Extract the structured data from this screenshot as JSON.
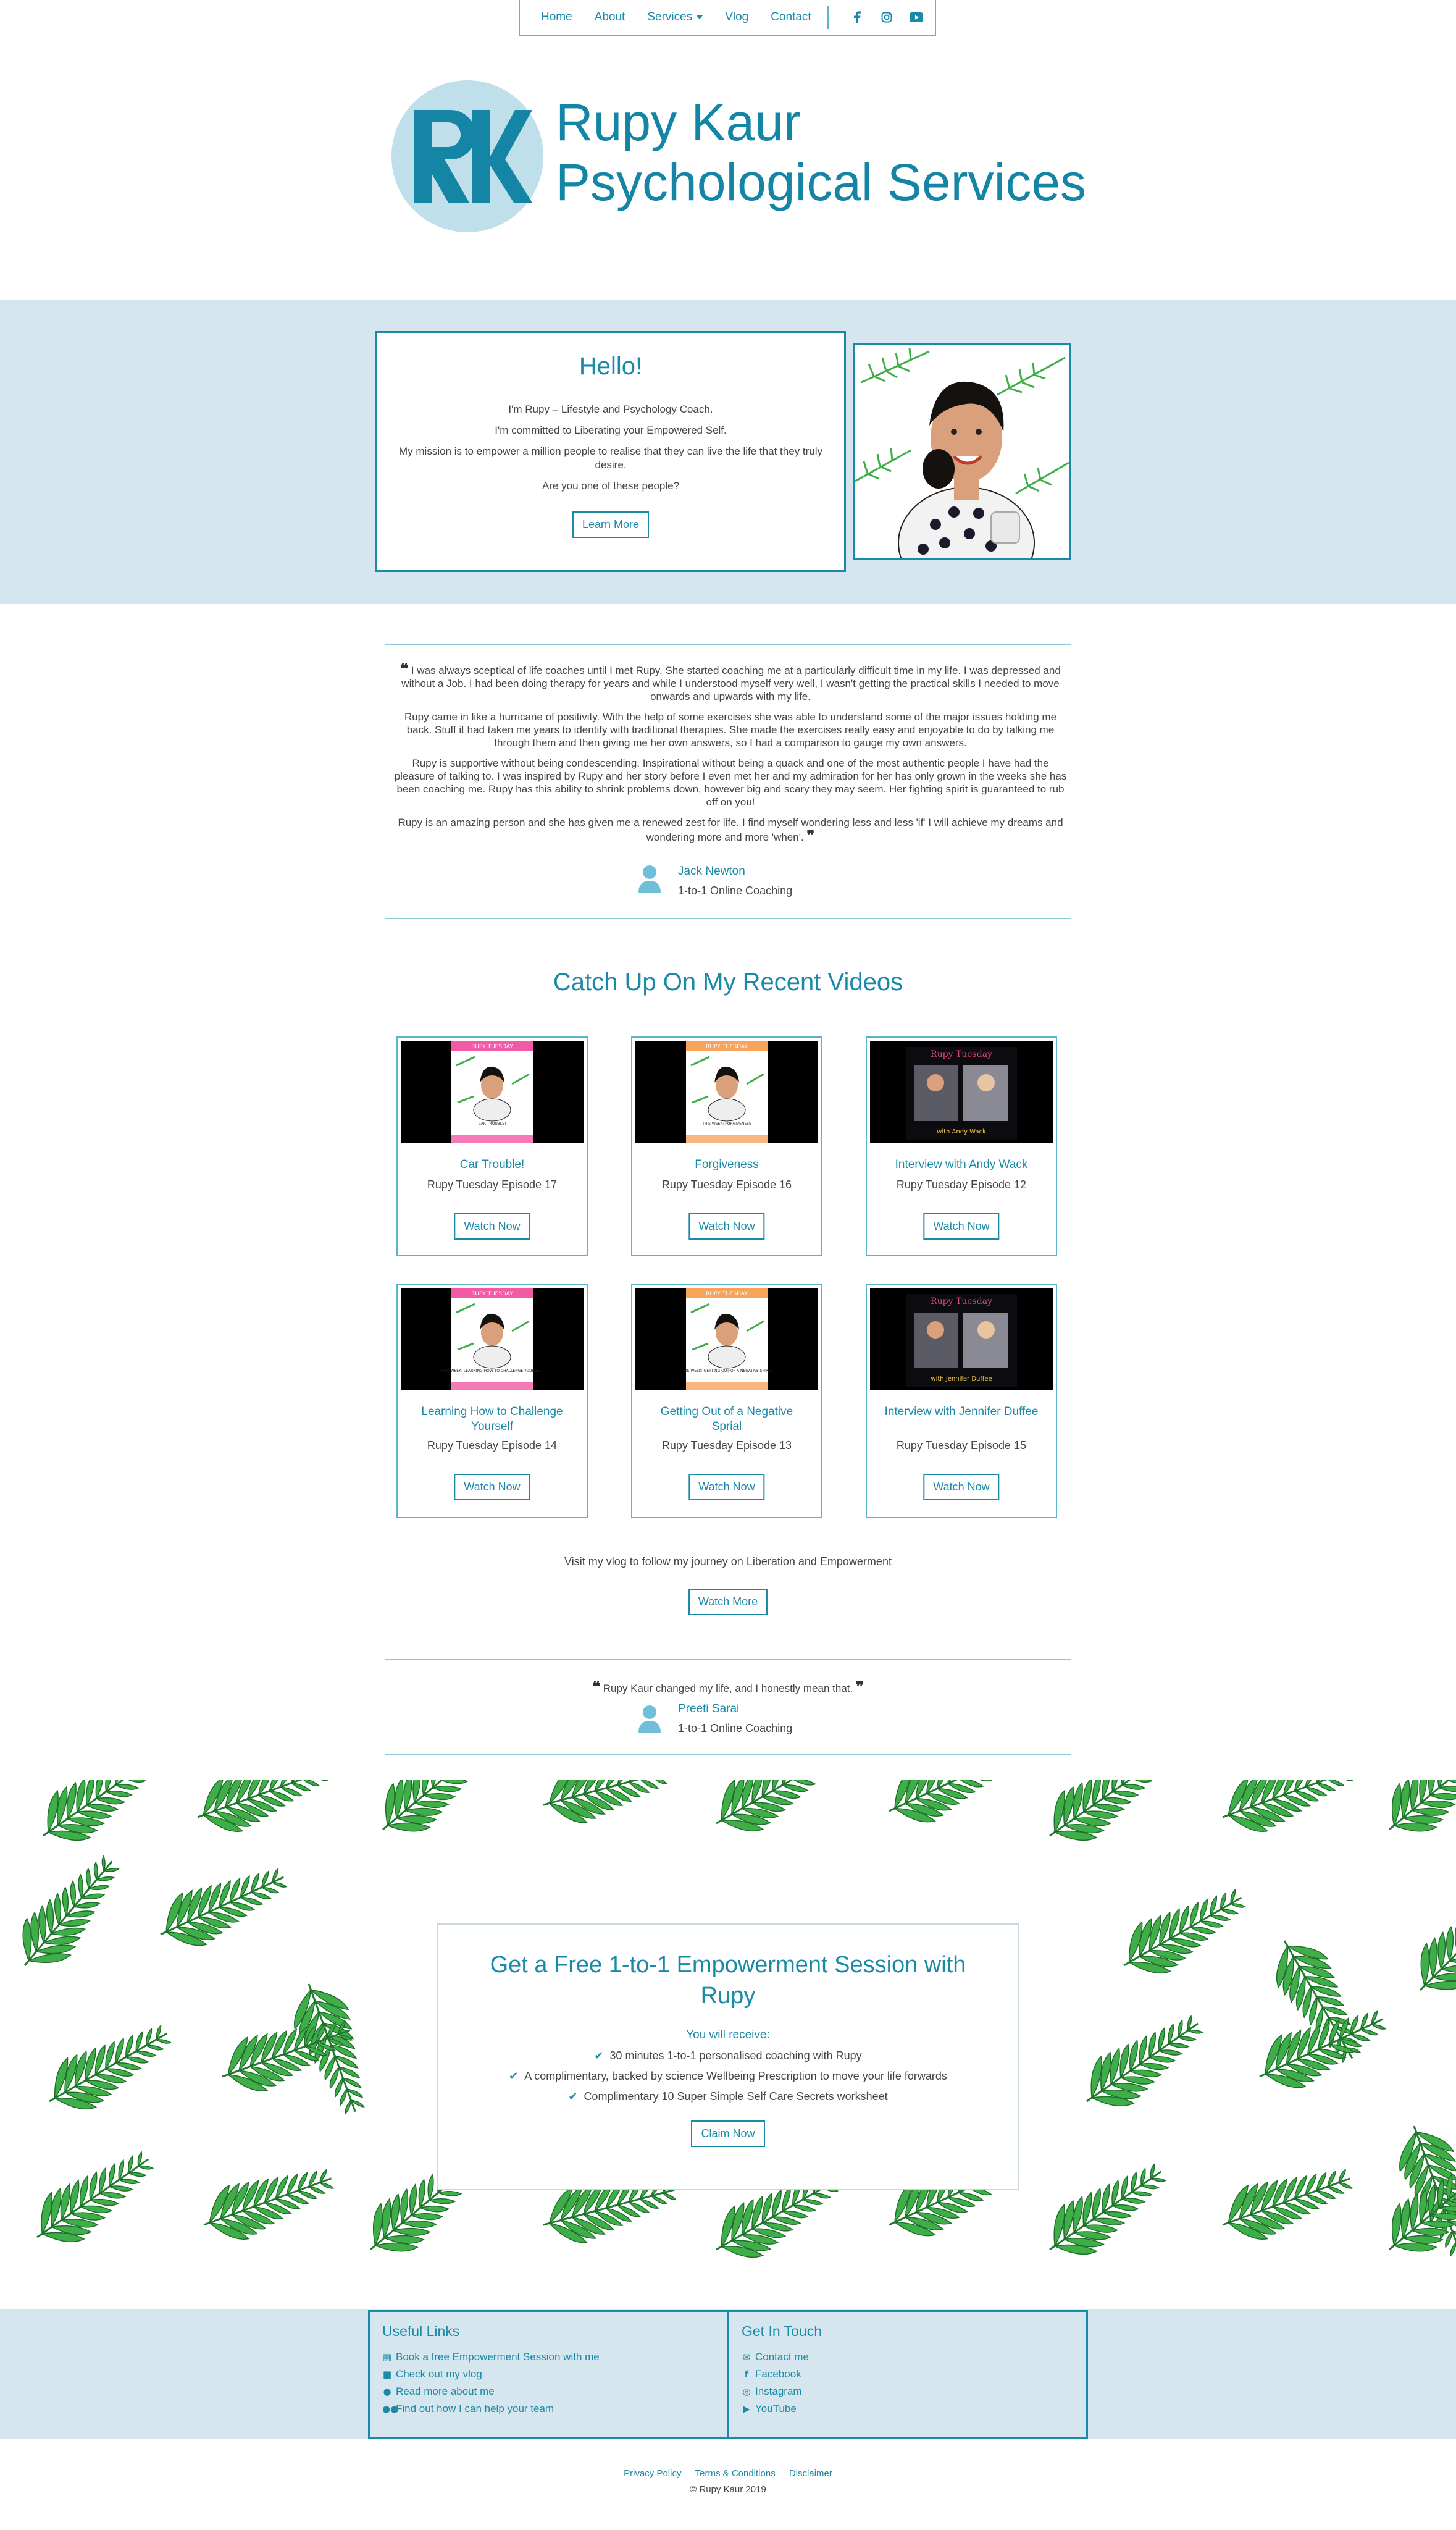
{
  "nav": {
    "items": [
      "Home",
      "About",
      "Services",
      "Vlog",
      "Contact"
    ],
    "social_icons": [
      "facebook-icon",
      "instagram-icon",
      "youtube-icon"
    ]
  },
  "logo": {
    "monogram": "RK",
    "line1": "Rupy Kaur",
    "line2": "Psychological Services"
  },
  "hero": {
    "title": "Hello!",
    "p1": "I'm Rupy – Lifestyle and Psychology Coach.",
    "p2": "I'm committed to Liberating your Empowered Self.",
    "p3": "My mission is to empower a million people to realise that they can live the life that they truly desire.",
    "p4": "Are you one of these people?",
    "button": "Learn More"
  },
  "testimonial1": {
    "paragraphs": [
      "I was always sceptical of life coaches until I met Rupy. She started coaching me at a particularly difficult time in my life. I was depressed and without a Job. I had been doing therapy for years and while I understood myself very well, I wasn't getting the practical skills I needed to move onwards and upwards with my life.",
      "Rupy came in like a hurricane of positivity. With the help of some exercises she was able to understand some of the major issues holding me back. Stuff it had taken me years to identify with traditional therapies. She made the exercises really easy and enjoyable to do by talking me through them and then giving me her own answers, so I had a comparison to gauge my own answers.",
      "Rupy is supportive without being condescending. Inspirational without being a quack and one of the most authentic people I have had the pleasure of talking to. I was inspired by Rupy and her story before I even met her and my admiration for her has only grown in the weeks she has been coaching me. Rupy has this ability to shrink problems down, however big and scary they may seem. Her fighting spirit is guaranteed to rub off on you!",
      "Rupy is an amazing person and she has given me a renewed zest for life. I find myself wondering less and less 'if' I will achieve my dreams and wondering more and more 'when'."
    ],
    "name": "Jack Newton",
    "role": "1-to-1 Online Coaching"
  },
  "videos": {
    "title": "Catch Up On My Recent Videos",
    "items": [
      {
        "title": "Car Trouble!",
        "episode": "Rupy Tuesday Episode 17",
        "button": "Watch Now",
        "thumb_banner": "RUPY TUESDAY",
        "thumb_caption": "CAR TROUBLE!",
        "banner_color": "#f25aa6"
      },
      {
        "title": "Forgiveness",
        "episode": "Rupy Tuesday Episode 16",
        "button": "Watch Now",
        "thumb_banner": "RUPY TUESDAY",
        "thumb_caption": "THIS WEEK: FORGIVENESS",
        "banner_color": "#f7a35c"
      },
      {
        "title": "Interview with Andy Wack",
        "episode": "Rupy Tuesday Episode 12",
        "button": "Watch Now",
        "thumb_banner": "Rupy Tuesday",
        "thumb_caption": "with Andy Wack",
        "banner_color": "#e0457b"
      },
      {
        "title": "Learning How to Challenge Yourself",
        "episode": "Rupy Tuesday Episode 14",
        "button": "Watch Now",
        "thumb_banner": "RUPY TUESDAY",
        "thumb_caption": "THIS WEEK: LEARNING HOW TO CHALLENGE YOURSELF",
        "banner_color": "#f25aa6"
      },
      {
        "title": "Getting Out of a Negative Sprial",
        "episode": "Rupy Tuesday Episode 13",
        "button": "Watch Now",
        "thumb_banner": "RUPY TUESDAY",
        "thumb_caption": "THIS WEEK: GETTING OUT OF A NEGATIVE SPIRAL",
        "banner_color": "#f7a35c"
      },
      {
        "title": "Interview with Jennifer Duffee",
        "episode": "Rupy Tuesday Episode 15",
        "button": "Watch Now",
        "thumb_banner": "Rupy Tuesday",
        "thumb_caption": "with Jennifer Duffee",
        "banner_color": "#e0457b"
      }
    ],
    "vlog_text": "Visit my vlog to follow my journey on Liberation and Empowerment",
    "more_button": "Watch More"
  },
  "testimonial2": {
    "quote": "Rupy Kaur changed my life, and I honestly mean that.",
    "name": "Preeti Sarai",
    "role": "1-to-1 Online Coaching"
  },
  "cta": {
    "title": "Get a Free 1-to-1 Empowerment Session with Rupy",
    "subtitle": "You will receive:",
    "items": [
      "30 minutes 1-to-1 personalised coaching with Rupy",
      "A complimentary, backed by science Wellbeing Prescription to move your life forwards",
      "Complimentary 10 Super Simple Self Care Secrets worksheet"
    ],
    "button": "Claim Now"
  },
  "footer": {
    "useful_links_title": "Useful Links",
    "useful_links": [
      {
        "icon": "calendar-icon",
        "label": "Book a free Empowerment Session with me"
      },
      {
        "icon": "video-icon",
        "label": "Check out my vlog"
      },
      {
        "icon": "user-icon",
        "label": "Read more about me"
      },
      {
        "icon": "users-icon",
        "label": "Find out how I can help your team"
      }
    ],
    "contact_title": "Get In Touch",
    "contact_links": [
      {
        "icon": "envelope-icon",
        "label": "Contact me"
      },
      {
        "icon": "facebook-icon",
        "label": "Facebook"
      },
      {
        "icon": "instagram-icon",
        "label": "Instagram"
      },
      {
        "icon": "youtube-icon",
        "label": "YouTube"
      }
    ],
    "legal": [
      "Privacy Policy",
      "Terms & Conditions",
      "Disclaimer"
    ],
    "copyright": "© Rupy Kaur 2019"
  },
  "colors": {
    "accent": "#1a8aa8",
    "band": "#d6e6ee",
    "leaf": "#3fae49"
  }
}
